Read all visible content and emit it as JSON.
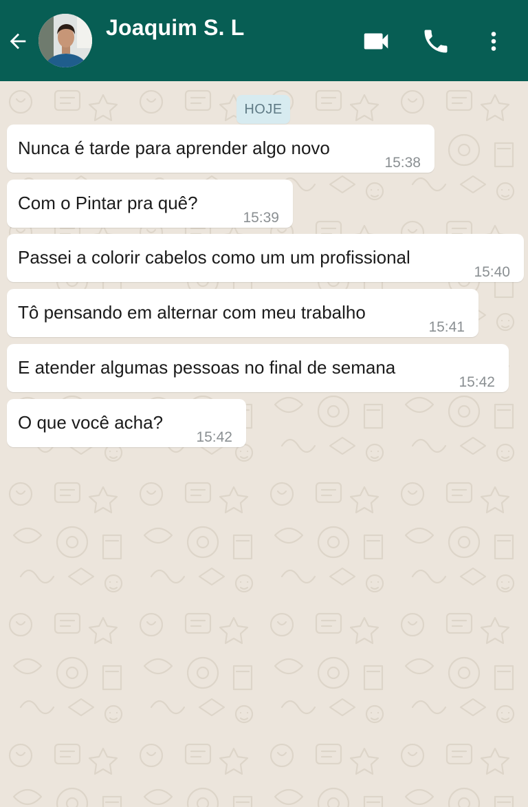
{
  "header": {
    "contact_name": "Joaquim S. L",
    "back_icon": "arrow-left-icon",
    "video_icon": "video-camera-icon",
    "call_icon": "phone-icon",
    "menu_icon": "more-vertical-icon",
    "background_color": "#075e54"
  },
  "chat": {
    "date_label": "HOJE",
    "messages": [
      {
        "text": "Nunca é tarde para aprender algo novo",
        "time": "15:38"
      },
      {
        "text": "Com o Pintar pra quê?",
        "time": "15:39"
      },
      {
        "text": "Passei a colorir cabelos como um um profissional",
        "time": "15:40"
      },
      {
        "text": "Tô pensando em alternar com meu trabalho",
        "time": "15:41"
      },
      {
        "text": "E atender algumas pessoas no final de semana",
        "time": "15:42"
      },
      {
        "text": "O que você acha?",
        "time": "15:42"
      }
    ]
  }
}
